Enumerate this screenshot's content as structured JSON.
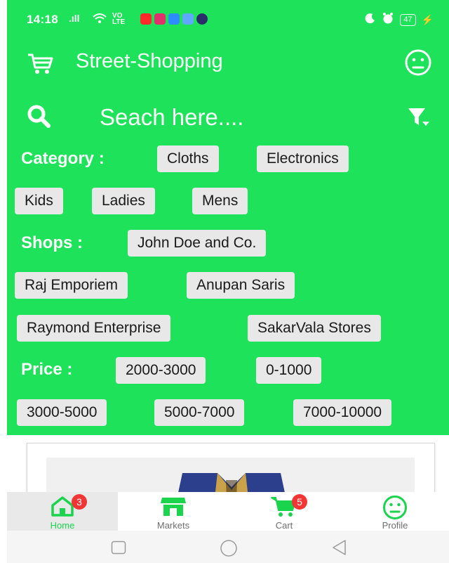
{
  "status_bar": {
    "time": "14:18",
    "signal": ".ıll",
    "battery": "47"
  },
  "app": {
    "title": "Street-Shopping"
  },
  "search": {
    "placeholder": "Seach here...."
  },
  "category": {
    "label": "Category :",
    "chips": [
      "Cloths",
      "Electronics",
      "Kids",
      "Ladies",
      "Mens"
    ]
  },
  "shops": {
    "label": "Shops :",
    "chips": [
      "John Doe and Co.",
      "Raj Emporiem",
      "Anupan Saris",
      "Raymond Enterprise",
      "SakarVala Stores"
    ]
  },
  "price": {
    "label": "Price :",
    "chips": [
      "2000-3000",
      "0-1000",
      "3000-5000",
      "5000-7000",
      "7000-10000"
    ]
  },
  "bottom_nav": {
    "tabs": [
      {
        "label": "Home",
        "badge": "3",
        "active": true
      },
      {
        "label": "Markets"
      },
      {
        "label": "Cart",
        "badge": "5"
      },
      {
        "label": "Profile"
      }
    ]
  },
  "colors": {
    "primary": "#1ee35a",
    "chip": "#e8e8e8",
    "badge": "#f23535",
    "active_tab_text": "#19d44c"
  }
}
